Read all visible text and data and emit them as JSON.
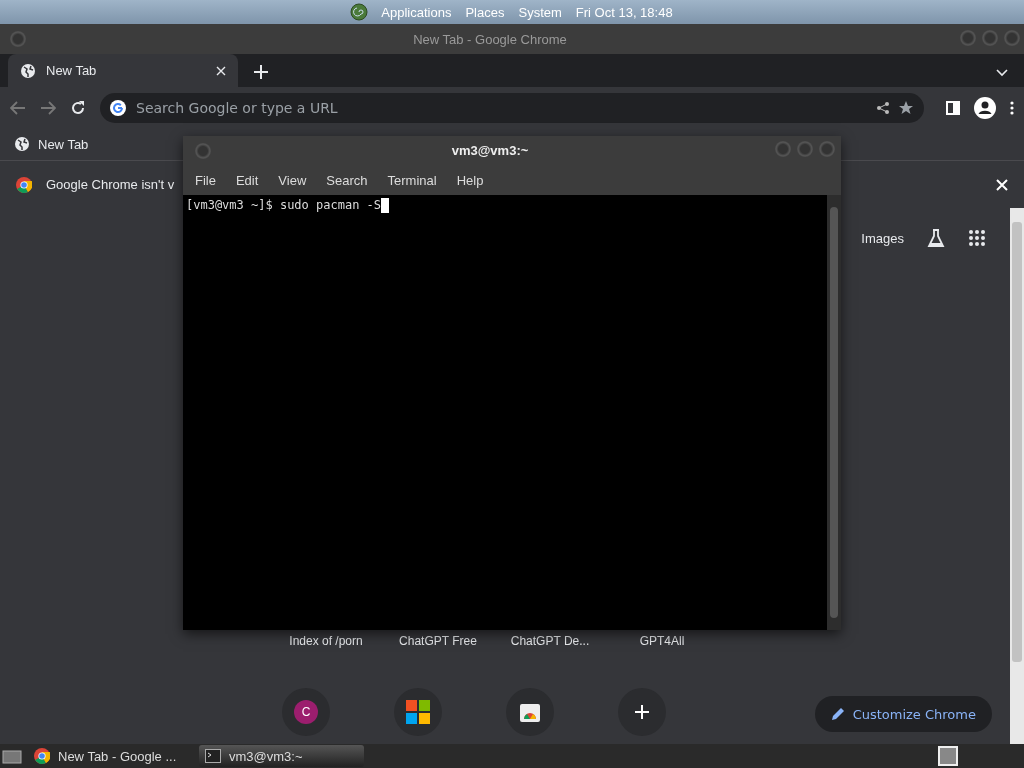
{
  "top_panel": {
    "menus": [
      "Applications",
      "Places",
      "System"
    ],
    "clock": "Fri Oct 13, 18:48"
  },
  "browser": {
    "title": "New Tab - Google Chrome",
    "tabs": [
      {
        "label": "New Tab",
        "selected": true
      }
    ],
    "omnibox": {
      "placeholder": "Search Google or type a URL"
    },
    "bookmarks": [
      "New Tab"
    ],
    "infobar": {
      "message": "Google Chrome isn't v"
    },
    "header_links": [
      "Images"
    ],
    "shortcut_titles": [
      "Index of /porn",
      "ChatGPT Free",
      "ChatGPT De...",
      "GPT4All"
    ],
    "shortcut_icons": [
      {
        "kind": "letter",
        "letter": "C"
      },
      {
        "kind": "windows"
      },
      {
        "kind": "store"
      },
      {
        "kind": "add"
      }
    ],
    "customize_button": "Customize Chrome"
  },
  "terminal": {
    "title": "vm3@vm3:~",
    "menu": [
      "File",
      "Edit",
      "View",
      "Search",
      "Terminal",
      "Help"
    ],
    "prompt": "[vm3@vm3 ~]$ sudo pacman -S"
  },
  "taskbar": {
    "tasks": [
      {
        "kind": "chrome",
        "label": "New Tab - Google ...",
        "selected": false
      },
      {
        "kind": "terminal",
        "label": "vm3@vm3:~",
        "selected": true
      }
    ]
  }
}
